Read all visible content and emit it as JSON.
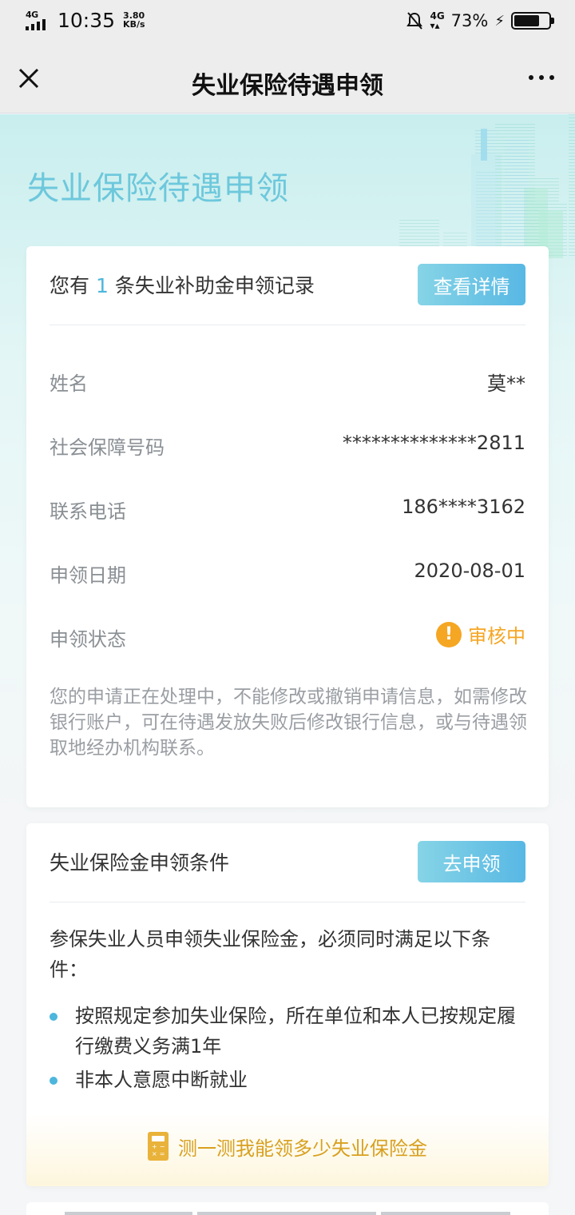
{
  "status_bar": {
    "network": "4G",
    "time": "10:35",
    "speed_value": "3.80",
    "speed_unit": "KB/s",
    "network_right": "4G",
    "battery_percent": "73%",
    "battery_level": 0.73
  },
  "nav": {
    "title": "失业保险待遇申领",
    "close_icon": "close-icon",
    "more_icon": "more-icon"
  },
  "hero": {
    "title": "失业保险待遇申领"
  },
  "record_card": {
    "title_prefix": "您有",
    "count": "1",
    "title_suffix": "条失业补助金申领记录",
    "detail_button": "查看详情",
    "fields": [
      {
        "label": "姓名",
        "value": "莫**"
      },
      {
        "label": "社会保障号码",
        "value": "**************2811"
      },
      {
        "label": "联系电话",
        "value": "186****3162"
      },
      {
        "label": "申领日期",
        "value": "2020-08-01"
      },
      {
        "label": "申领状态",
        "value": "审核中"
      }
    ],
    "status_color": "#f5a623",
    "notice": "您的申请正在处理中，不能修改或撤销申请信息，如需修改银行账户，可在待遇发放失败后修改银行信息，或与待遇领取地经办机构联系。"
  },
  "conditions_card": {
    "title": "失业保险金申领条件",
    "apply_button": "去申领",
    "intro": "参保失业人员申领失业保险金，必须同时满足以下条件：",
    "conditions": [
      "按照规定参加失业保险，所在单位和本人已按规定履行缴费义务满1年",
      "非本人意愿中断就业"
    ],
    "calc_link": "测一测我能领多少失业保险金"
  },
  "colors": {
    "accent": "#4db6dc",
    "hero_title": "#6dc8dc",
    "warning": "#f5a623"
  }
}
